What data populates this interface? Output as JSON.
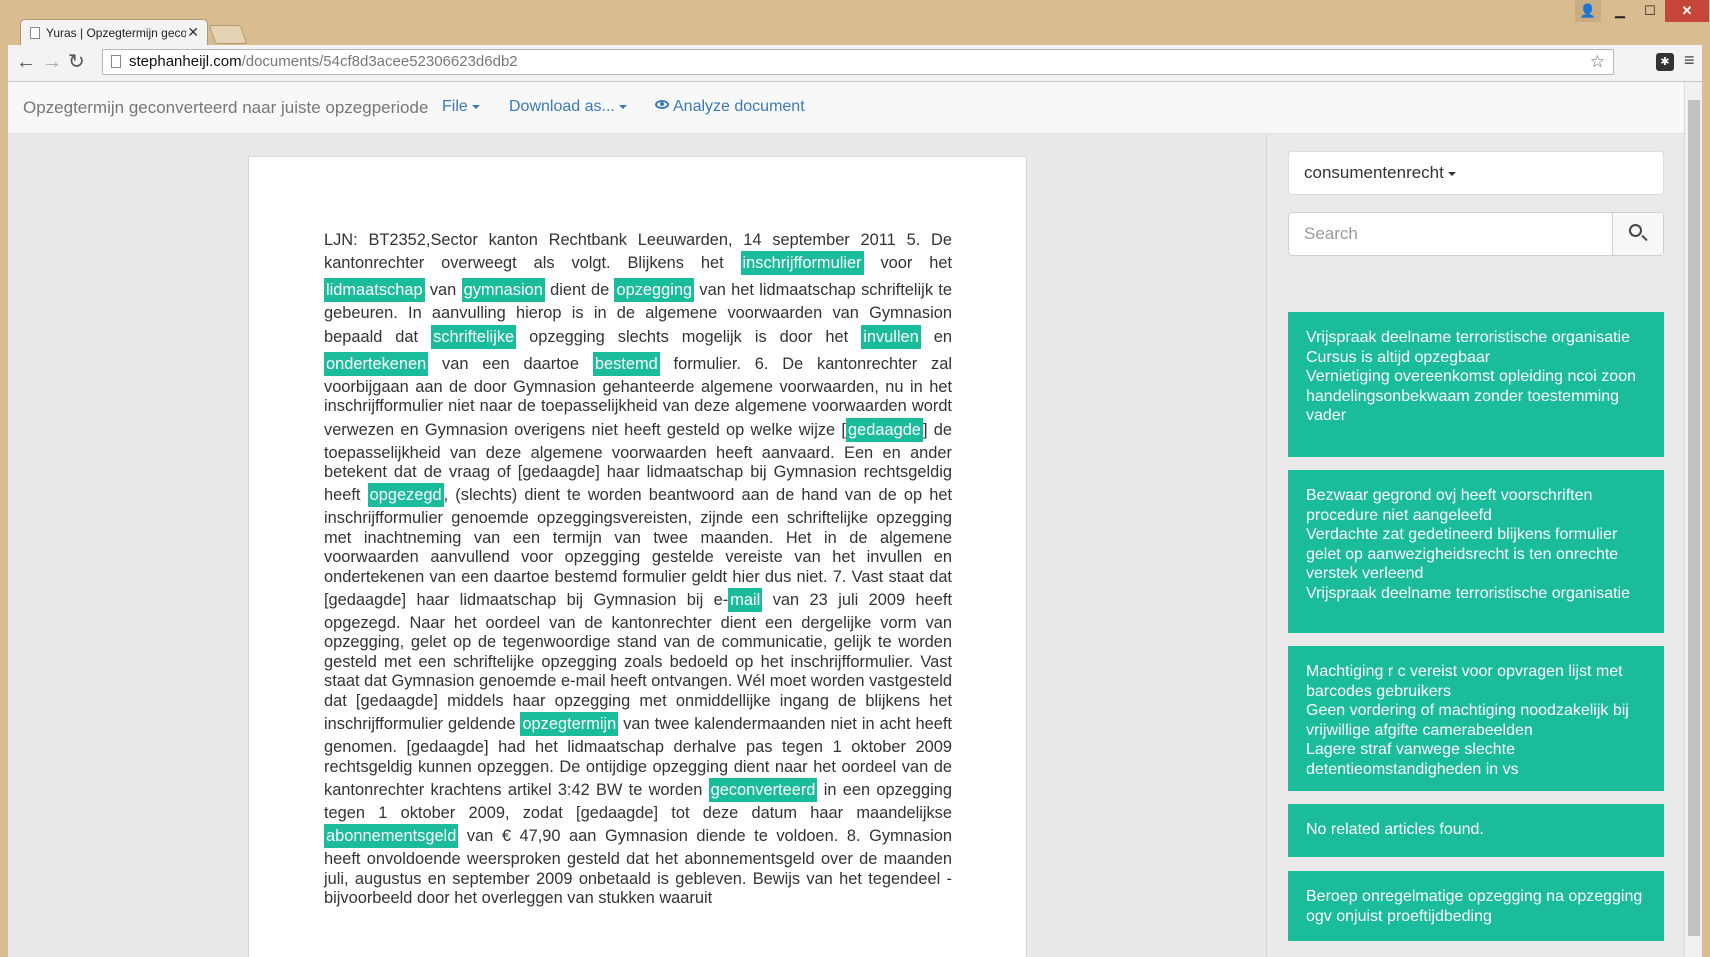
{
  "browser": {
    "tab_title": "Yuras | Opzegtermijn geco",
    "url_domain": "stephanheijl.com",
    "url_path": "/documents/54cf8d3acee52306623d6db2"
  },
  "navbar": {
    "brand": "Opzegtermijn geconverteerd naar juiste opzegperiode",
    "file_label": "File",
    "download_label": "Download as...",
    "analyze_label": "Analyze document"
  },
  "document": {
    "segments": [
      {
        "t": "LJN: BT2352,Sector kanton Rechtbank Leeuwarden, 14 september 2011 5.  De kantonrechter overweegt als volgt. Blijkens het "
      },
      {
        "t": "inschrijfformulier",
        "h": true
      },
      {
        "t": " voor het "
      },
      {
        "t": "lidmaatschap",
        "h": true
      },
      {
        "t": " van "
      },
      {
        "t": "gymnasion",
        "h": true
      },
      {
        "t": " dient de "
      },
      {
        "t": "opzegging",
        "h": true
      },
      {
        "t": " van het lidmaatschap schriftelijk te gebeuren. In aanvulling hierop is in de algemene voorwaarden van Gymnasion bepaald dat "
      },
      {
        "t": "schriftelijke",
        "h": true
      },
      {
        "t": " opzegging slechts mogelijk is door het "
      },
      {
        "t": "invullen",
        "h": true
      },
      {
        "t": " en "
      },
      {
        "t": "ondertekenen",
        "h": true
      },
      {
        "t": " van een daartoe "
      },
      {
        "t": "bestemd",
        "h": true
      },
      {
        "t": " formulier. 6.  De kantonrechter zal voorbijgaan aan de door Gymnasion gehanteerde algemene voorwaarden, nu in het inschrijfformulier niet naar de toepasselijkheid van deze algemene voorwaarden wordt verwezen en Gymnasion overigens niet heeft gesteld op welke wijze ["
      },
      {
        "t": "gedaagde",
        "h": true
      },
      {
        "t": "] de toepasselijkheid van deze algemene voorwaarden heeft aanvaard. Een en ander betekent dat de vraag of [gedaagde] haar lidmaatschap bij Gymnasion rechtsgeldig heeft "
      },
      {
        "t": "opgezegd",
        "h": true
      },
      {
        "t": ", (slechts) dient te worden beantwoord aan de hand van de op het inschrijfformulier genoemde opzeggingsvereisten, zijnde een schriftelijke opzegging met inachtneming van een termijn van twee maanden. Het in de algemene voorwaarden aanvullend voor opzegging gestelde vereiste van het invullen en ondertekenen van een daartoe bestemd formulier geldt hier dus niet. 7.  Vast staat dat [gedaagde] haar lidmaatschap bij Gymnasion bij e-"
      },
      {
        "t": "mail",
        "h": true
      },
      {
        "t": " van 23 juli 2009 heeft opgezegd. Naar het oordeel van de kantonrechter dient een dergelijke vorm van opzegging, gelet op de tegenwoordige stand van de communicatie, gelijk te worden gesteld met een schriftelijke opzegging zoals bedoeld op het inschrijfformulier. Vast staat dat Gymnasion genoemde e-mail heeft ontvangen. Wél moet worden vastgesteld dat [gedaagde] middels haar opzegging met onmiddellijke ingang de blijkens het inschrijfformulier geldende "
      },
      {
        "t": "opzegtermijn",
        "h": true
      },
      {
        "t": " van twee kalendermaanden niet in acht heeft genomen. [gedaagde] had het lidmaatschap derhalve pas tegen 1 oktober 2009 rechtsgeldig kunnen opzeggen. De ontijdige opzegging dient naar het oordeel van de kantonrechter krachtens artikel 3:42 BW te worden "
      },
      {
        "t": "geconverteerd",
        "h": true
      },
      {
        "t": " in een opzegging tegen 1 oktober 2009, zodat [gedaagde] tot deze datum haar maandelijkse "
      },
      {
        "t": "abonnementsgeld",
        "h": true
      },
      {
        "t": " van € 47,90 aan Gymnasion diende te voldoen. 8.  Gymnasion heeft onvoldoende weersproken gesteld dat het abonnementsgeld over de maanden juli, augustus en september 2009 onbetaald is gebleven. Bewijs van het tegendeel - bijvoorbeeld door het overleggen van stukken waaruit"
      }
    ]
  },
  "sidebar": {
    "category": "consumentenrecht",
    "search_placeholder": "Search",
    "cards": [
      [
        "Vrijspraak deelname terroristische organisatie",
        "Cursus is altijd opzegbaar",
        "Vernietiging overeenkomst opleiding ncoi zoon handelingsonbekwaam zonder toestemming vader"
      ],
      [
        "Bezwaar gegrond ovj heeft voorschriften procedure niet aangeleefd",
        "Verdachte zat gedetineerd blijkens formulier gelet op aanwezigheidsrecht is ten onrechte verstek verleend",
        "Vrijspraak deelname terroristische organisatie"
      ],
      [
        "Machtiging r c vereist voor opvragen lijst met barcodes gebruikers",
        "Geen vordering of machtiging noodzakelijk bij vrijwillige afgifte camerabeelden",
        "Lagere straf vanwege slechte detentieomstandigheden in vs"
      ],
      [
        "No related articles found."
      ],
      [
        "Beroep onregelmatige opzegging na opzegging ogv onjuist proeftijdbeding"
      ]
    ]
  },
  "colors": {
    "accent": "#1abc9c",
    "link": "#3b7ab8",
    "window_frame": "#d9bc8f"
  }
}
